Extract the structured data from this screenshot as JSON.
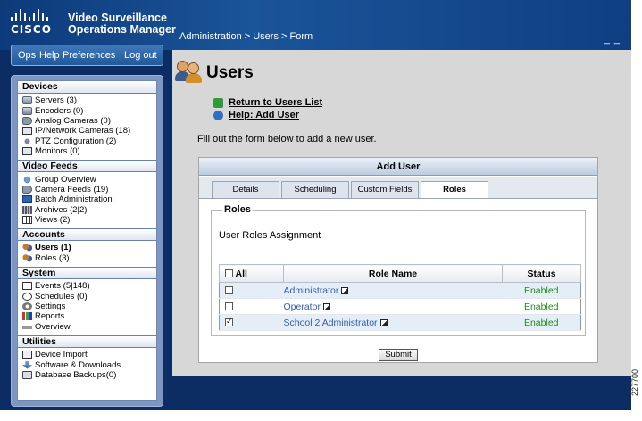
{
  "app": {
    "brand": "CISCO",
    "title_line1": "Video Surveillance",
    "title_line2": "Operations Manager",
    "breadcrumb": "Administration > Users > Form",
    "window_controls": "_ _"
  },
  "topnav": {
    "ops": "Ops",
    "help": "Help",
    "preferences": "Preferences",
    "logout": "Log out"
  },
  "sidebar": {
    "devices": {
      "heading": "Devices",
      "items": [
        {
          "label": "Servers (3)",
          "icon": "server-icon"
        },
        {
          "label": "Encoders (0)",
          "icon": "encoder-icon"
        },
        {
          "label": "Analog Cameras (0)",
          "icon": "analog-camera-icon"
        },
        {
          "label": "IP/Network Cameras (18)",
          "icon": "network-camera-icon"
        },
        {
          "label": "PTZ Configuration (2)",
          "icon": "ptz-icon"
        },
        {
          "label": "Monitors (0)",
          "icon": "monitor-icon"
        }
      ]
    },
    "video_feeds": {
      "heading": "Video Feeds",
      "items": [
        {
          "label": "Group Overview",
          "icon": "globe-icon"
        },
        {
          "label": "Camera Feeds (19)",
          "icon": "camera-feeds-icon"
        },
        {
          "label": "Batch Administration",
          "icon": "batch-icon"
        },
        {
          "label": "Archives (2|2)",
          "icon": "archive-icon"
        },
        {
          "label": "Views (2)",
          "icon": "views-icon"
        }
      ]
    },
    "accounts": {
      "heading": "Accounts",
      "items": [
        {
          "label": "Users (1)",
          "icon": "users-icon"
        },
        {
          "label": "Roles (3)",
          "icon": "roles-icon"
        }
      ]
    },
    "system": {
      "heading": "System",
      "items": [
        {
          "label": "Events (5|148)",
          "icon": "events-icon"
        },
        {
          "label": "Schedules (0)",
          "icon": "schedule-icon"
        },
        {
          "label": "Settings",
          "icon": "settings-icon"
        },
        {
          "label": "Reports",
          "icon": "reports-icon"
        },
        {
          "label": "Overview",
          "icon": "overview-icon"
        }
      ]
    },
    "utilities": {
      "heading": "Utilities",
      "items": [
        {
          "label": "Device Import",
          "icon": "import-icon"
        },
        {
          "label": "Software & Downloads",
          "icon": "download-icon"
        },
        {
          "label": "Database Backups(0)",
          "icon": "database-icon"
        }
      ]
    }
  },
  "main": {
    "title": "Users",
    "return_link": "Return to Users List",
    "help_link": "Help: Add User",
    "instructions": "Fill out the form below to add a new user.",
    "form_title": "Add User",
    "tabs": [
      "Details",
      "Scheduling",
      "Custom Fields",
      "Roles"
    ],
    "active_tab": "Roles",
    "roles_legend": "Roles",
    "roles_subtitle": "User Roles Assignment",
    "table": {
      "headers": {
        "all": "All",
        "role_name": "Role Name",
        "status": "Status"
      },
      "rows": [
        {
          "name": "Administrator",
          "status": "Enabled",
          "checked": false
        },
        {
          "name": "Operator",
          "status": "Enabled",
          "checked": false
        },
        {
          "name": "School 2 Administrator",
          "status": "Enabled",
          "checked": true
        }
      ]
    },
    "submit_label": "Submit"
  },
  "figure_number": "227700",
  "colors": {
    "accent": "#1a5499",
    "status_enabled": "#1f8c1f",
    "link": "#2b63b8"
  }
}
